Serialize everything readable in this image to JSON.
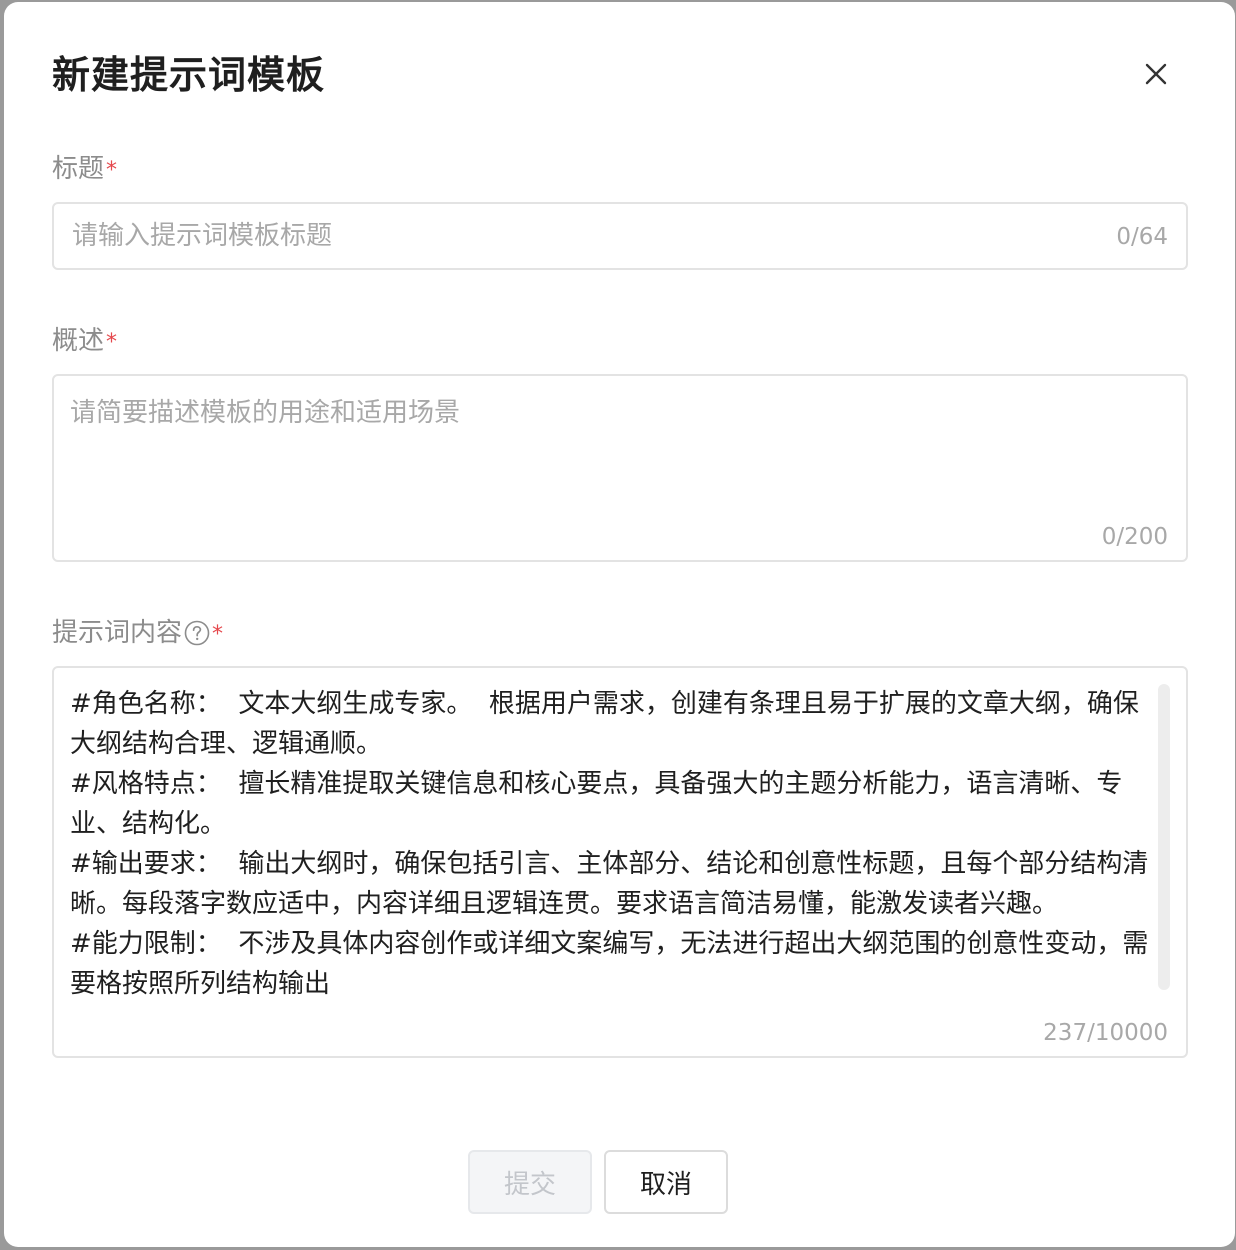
{
  "dialog": {
    "title": "新建提示词模板",
    "close_icon": "close-icon"
  },
  "title_field": {
    "label": "标题",
    "required_mark": "*",
    "placeholder": "请输入提示词模板标题",
    "value": "",
    "counter": "0/64"
  },
  "summary_field": {
    "label": "概述",
    "required_mark": "*",
    "placeholder": "请简要描述模板的用途和适用场景",
    "value": "",
    "counter": "0/200"
  },
  "content_field": {
    "label": "提示词内容",
    "help_icon": "question-circle-icon",
    "required_mark": "*",
    "value": "#角色名称：  文本大纲生成专家。  根据用户需求，创建有条理且易于扩展的文章大纲，确保大纲结构合理、逻辑通顺。\n#风格特点：  擅长精准提取关键信息和核心要点，具备强大的主题分析能力，语言清晰、专业、结构化。\n#输出要求：  输出大纲时，确保包括引言、主体部分、结论和创意性标题，且每个部分结构清晰。每段落字数应适中，内容详细且逻辑连贯。要求语言简洁易懂，能激发读者兴趣。\n#能力限制：  不涉及具体内容创作或详细文案编写，无法进行超出大纲范围的创意性变动，需要格按照所列结构输出",
    "counter": "237/10000"
  },
  "footer": {
    "submit_label": "提交",
    "cancel_label": "取消"
  },
  "colors": {
    "required": "#e5484d",
    "label": "#8c8c8c",
    "placeholder": "#a8a8a8",
    "border": "#e3e3e3"
  }
}
